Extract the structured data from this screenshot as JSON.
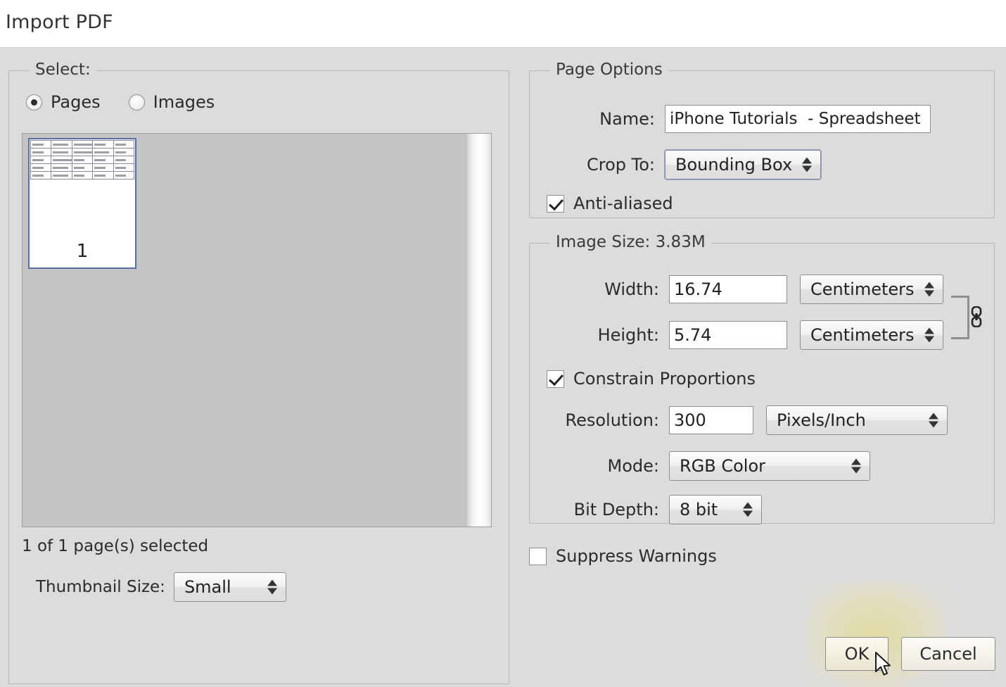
{
  "dialog": {
    "title": "Import PDF"
  },
  "select": {
    "group_title": "Select:",
    "radios": [
      {
        "label": "Pages",
        "checked": true
      },
      {
        "label": "Images",
        "checked": false
      }
    ],
    "thumbnail": {
      "page_number": "1"
    },
    "pages_selected_text": "1 of 1 page(s) selected",
    "thumbnail_size_label": "Thumbnail Size:",
    "thumbnail_size_value": "Small"
  },
  "page_options": {
    "group_title": "Page Options",
    "name_label": "Name:",
    "name_value": "iPhone Tutorials  - Spreadsheet",
    "name_placeholder": "Name",
    "crop_to_label": "Crop To:",
    "crop_to_value": "Bounding Box",
    "anti_aliased_label": "Anti-aliased",
    "anti_aliased_checked": true
  },
  "image_size": {
    "group_title": "Image Size: 3.83M",
    "width_label": "Width:",
    "width_value": "16.74",
    "width_unit": "Centimeters",
    "height_label": "Height:",
    "height_value": "5.74",
    "height_unit": "Centimeters",
    "constrain_label": "Constrain Proportions",
    "constrain_checked": true,
    "resolution_label": "Resolution:",
    "resolution_value": "300",
    "resolution_unit": "Pixels/Inch",
    "mode_label": "Mode:",
    "mode_value": "RGB Color",
    "bit_depth_label": "Bit Depth:",
    "bit_depth_value": "8 bit"
  },
  "footer": {
    "suppress_warnings_label": "Suppress Warnings",
    "suppress_warnings_checked": false,
    "ok_label": "OK",
    "cancel_label": "Cancel"
  },
  "colors": {
    "dialog_background": "#dcdcdc",
    "titlebar_background": "#ffffff",
    "thumbnail_list_background": "#c5c5c5",
    "thumbnail_selection_border": "#5a6fa0",
    "button_highlight": "#e2db96"
  }
}
